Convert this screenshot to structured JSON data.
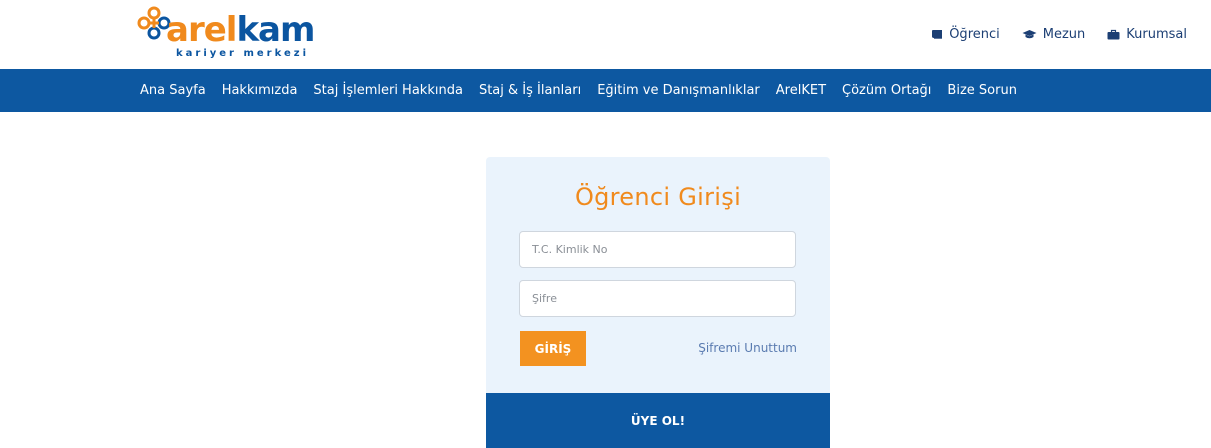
{
  "brand": {
    "name_part1": "arel",
    "name_part2": "kam",
    "tagline": "kariyer merkezi",
    "colors": {
      "blue": "#0d58a1",
      "orange": "#f08a1d"
    }
  },
  "top_links": [
    {
      "label": "Öğrenci",
      "icon": "book-icon"
    },
    {
      "label": "Mezun",
      "icon": "graduation-cap-icon"
    },
    {
      "label": "Kurumsal",
      "icon": "briefcase-icon"
    }
  ],
  "nav": {
    "items": [
      "Ana Sayfa",
      "Hakkımızda",
      "Staj İşlemleri Hakkında",
      "Staj & İş İlanları",
      "Eğitim ve Danışmanlıklar",
      "ArelKET",
      "Çözüm Ortağı",
      "Bize Sorun"
    ]
  },
  "login": {
    "title": "Öğrenci Girişi",
    "tc_placeholder": "T.C. Kimlik No",
    "tc_value": "",
    "password_placeholder": "Şifre",
    "password_value": "",
    "submit_label": "GİRİŞ",
    "forgot_label": "Şifremi Unuttum",
    "signup_label": "ÜYE OL!"
  }
}
